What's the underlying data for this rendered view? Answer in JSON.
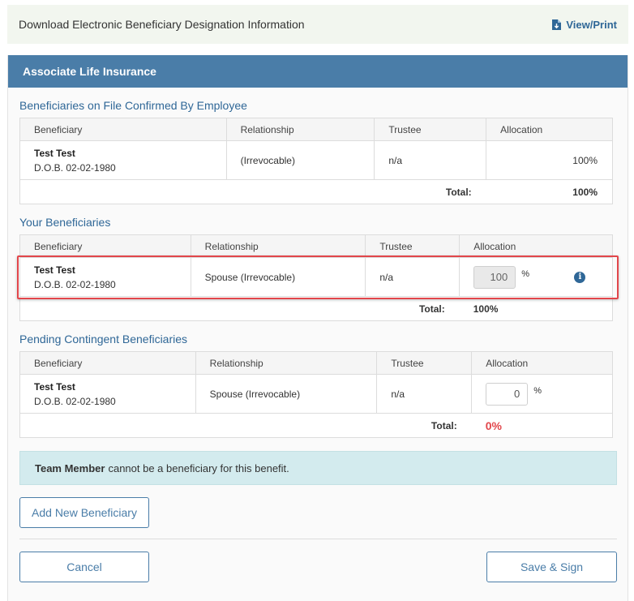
{
  "topbar": {
    "download_text": "Download Electronic Beneficiary Designation Information",
    "view_print_label": "View/Print"
  },
  "panel": {
    "title": "Associate Life Insurance"
  },
  "confirmed": {
    "title": "Beneficiaries on File Confirmed By Employee",
    "columns": [
      "Beneficiary",
      "Relationship",
      "Trustee",
      "Allocation"
    ],
    "row": {
      "name": "Test Test",
      "dob": "D.O.B. 02-02-1980",
      "relationship": "(Irrevocable)",
      "trustee": "n/a",
      "allocation": "100%"
    },
    "total_label": "Total:",
    "total_value": "100%"
  },
  "yours": {
    "title": "Your Beneficiaries",
    "columns": [
      "Beneficiary",
      "Relationship",
      "Trustee",
      "Allocation"
    ],
    "row": {
      "name": "Test Test",
      "dob": "D.O.B. 02-02-1980",
      "relationship": "Spouse (Irrevocable)",
      "trustee": "n/a",
      "allocation_value": "100",
      "pct": "%"
    },
    "total_label": "Total:",
    "total_value": "100%"
  },
  "pending": {
    "title": "Pending Contingent Beneficiaries",
    "columns": [
      "Beneficiary",
      "Relationship",
      "Trustee",
      "Allocation"
    ],
    "row": {
      "name": "Test Test",
      "dob": "D.O.B. 02-02-1980",
      "relationship": "Spouse (Irrevocable)",
      "trustee": "n/a",
      "allocation_value": "0",
      "pct": "%"
    },
    "total_label": "Total:",
    "total_value": "0%"
  },
  "alert": {
    "bold": "Team Member",
    "text": "cannot be a beneficiary for this benefit."
  },
  "buttons": {
    "add_new": "Add New Beneficiary",
    "cancel": "Cancel",
    "save_sign": "Save & Sign"
  },
  "colors": {
    "header_bar": "#4a7da8",
    "link_blue": "#2f6797",
    "highlight_border": "#e2464b",
    "pending_total": "#e2464b",
    "alert_bg": "#d3ebee"
  }
}
